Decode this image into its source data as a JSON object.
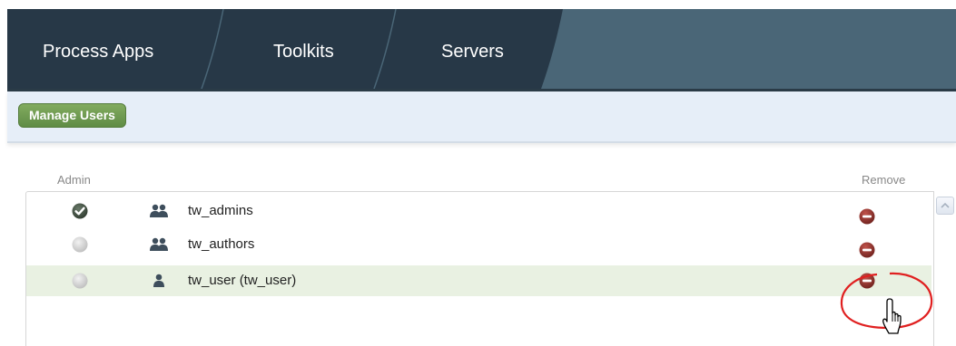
{
  "tabs": [
    {
      "label": "Process Apps"
    },
    {
      "label": "Toolkits"
    },
    {
      "label": "Servers"
    }
  ],
  "toolbar": {
    "manage_users_label": "Manage Users"
  },
  "table": {
    "col_admin": "Admin",
    "col_remove": "Remove",
    "rows": [
      {
        "name": "tw_admins",
        "admin": true,
        "type": "group",
        "selected": false
      },
      {
        "name": "tw_authors",
        "admin": false,
        "type": "group",
        "selected": false
      },
      {
        "name": "tw_user (tw_user)",
        "admin": false,
        "type": "user",
        "selected": true
      }
    ]
  },
  "colors": {
    "tab_active": "#273847",
    "tab_bar": "#4a6677",
    "toolbar_bg": "#e6eef8",
    "button_green": "#6d9a50",
    "admin_check": "#3a4a3a",
    "remove_red": "#8a2f2a",
    "selected_row": "#e9f1e2",
    "annotation_circle": "#e02020"
  },
  "icons": {
    "admin_on": "check-circle-icon",
    "admin_off": "grey-circle-icon",
    "group": "group-icon",
    "user": "user-icon",
    "remove": "remove-minus-icon",
    "cursor": "hand-pointer-icon"
  }
}
